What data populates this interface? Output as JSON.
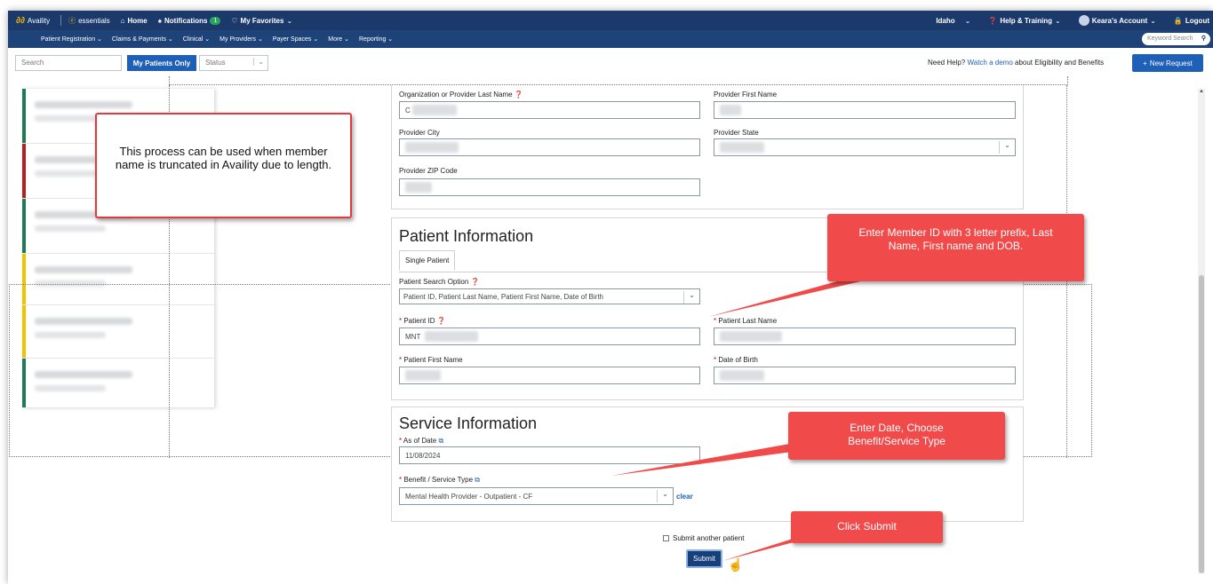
{
  "topbar": {
    "brand": "Availity",
    "essentials": "essentials",
    "home": "Home",
    "notifications": "Notifications",
    "notif_count": "1",
    "favorites": "My Favorites",
    "region": "Idaho",
    "help": "Help & Training",
    "account": "Keara's Account",
    "logout": "Logout"
  },
  "subnav": {
    "items": [
      "Patient Registration",
      "Claims & Payments",
      "Clinical",
      "My Providers",
      "Payer Spaces",
      "More",
      "Reporting"
    ],
    "keyword_placeholder": "Keyword Search"
  },
  "filters": {
    "search_placeholder": "Search",
    "my_patients": "My Patients Only",
    "status_placeholder": "Status"
  },
  "help_bar": {
    "prefix": "Need Help?",
    "link": "Watch a demo",
    "suffix": "about Eligibility and Benefits",
    "new_request": "New Request"
  },
  "provider": {
    "org_label": "Organization or Provider Last Name",
    "org_value": "C",
    "first_label": "Provider First Name",
    "city_label": "Provider City",
    "state_label": "Provider State",
    "zip_label": "Provider ZIP Code"
  },
  "patient": {
    "title": "Patient Information",
    "tab": "Single Patient",
    "search_option_label": "Patient Search Option",
    "search_option_value": "Patient ID, Patient Last Name, Patient First Name, Date of Birth",
    "id_label": "Patient ID",
    "id_value": "MNT",
    "last_label": "Patient Last Name",
    "first_label": "Patient First Name",
    "dob_label": "Date of Birth"
  },
  "service": {
    "title": "Service Information",
    "asof_label": "As of Date",
    "asof_value": "11/08/2024",
    "benefit_label": "Benefit / Service Type",
    "benefit_value": "Mental Health Provider - Outpatient - CF",
    "clear": "clear"
  },
  "submit": {
    "another": "Submit another patient",
    "button": "Submit"
  },
  "callouts": {
    "note": "This process can be used when member name is truncated in Availity due to length.",
    "member_id": "Enter Member ID with 3 letter prefix, Last Name, First name and DOB.",
    "date": "Enter Date, Choose Benefit/Service Type",
    "submit": "Click Submit"
  },
  "patient_cards": {
    "bar_colors": [
      "#1f7a5a",
      "#b51f1f",
      "#1f7a5a",
      "#f2c200",
      "#f2c200",
      "#1f7a5a"
    ]
  }
}
